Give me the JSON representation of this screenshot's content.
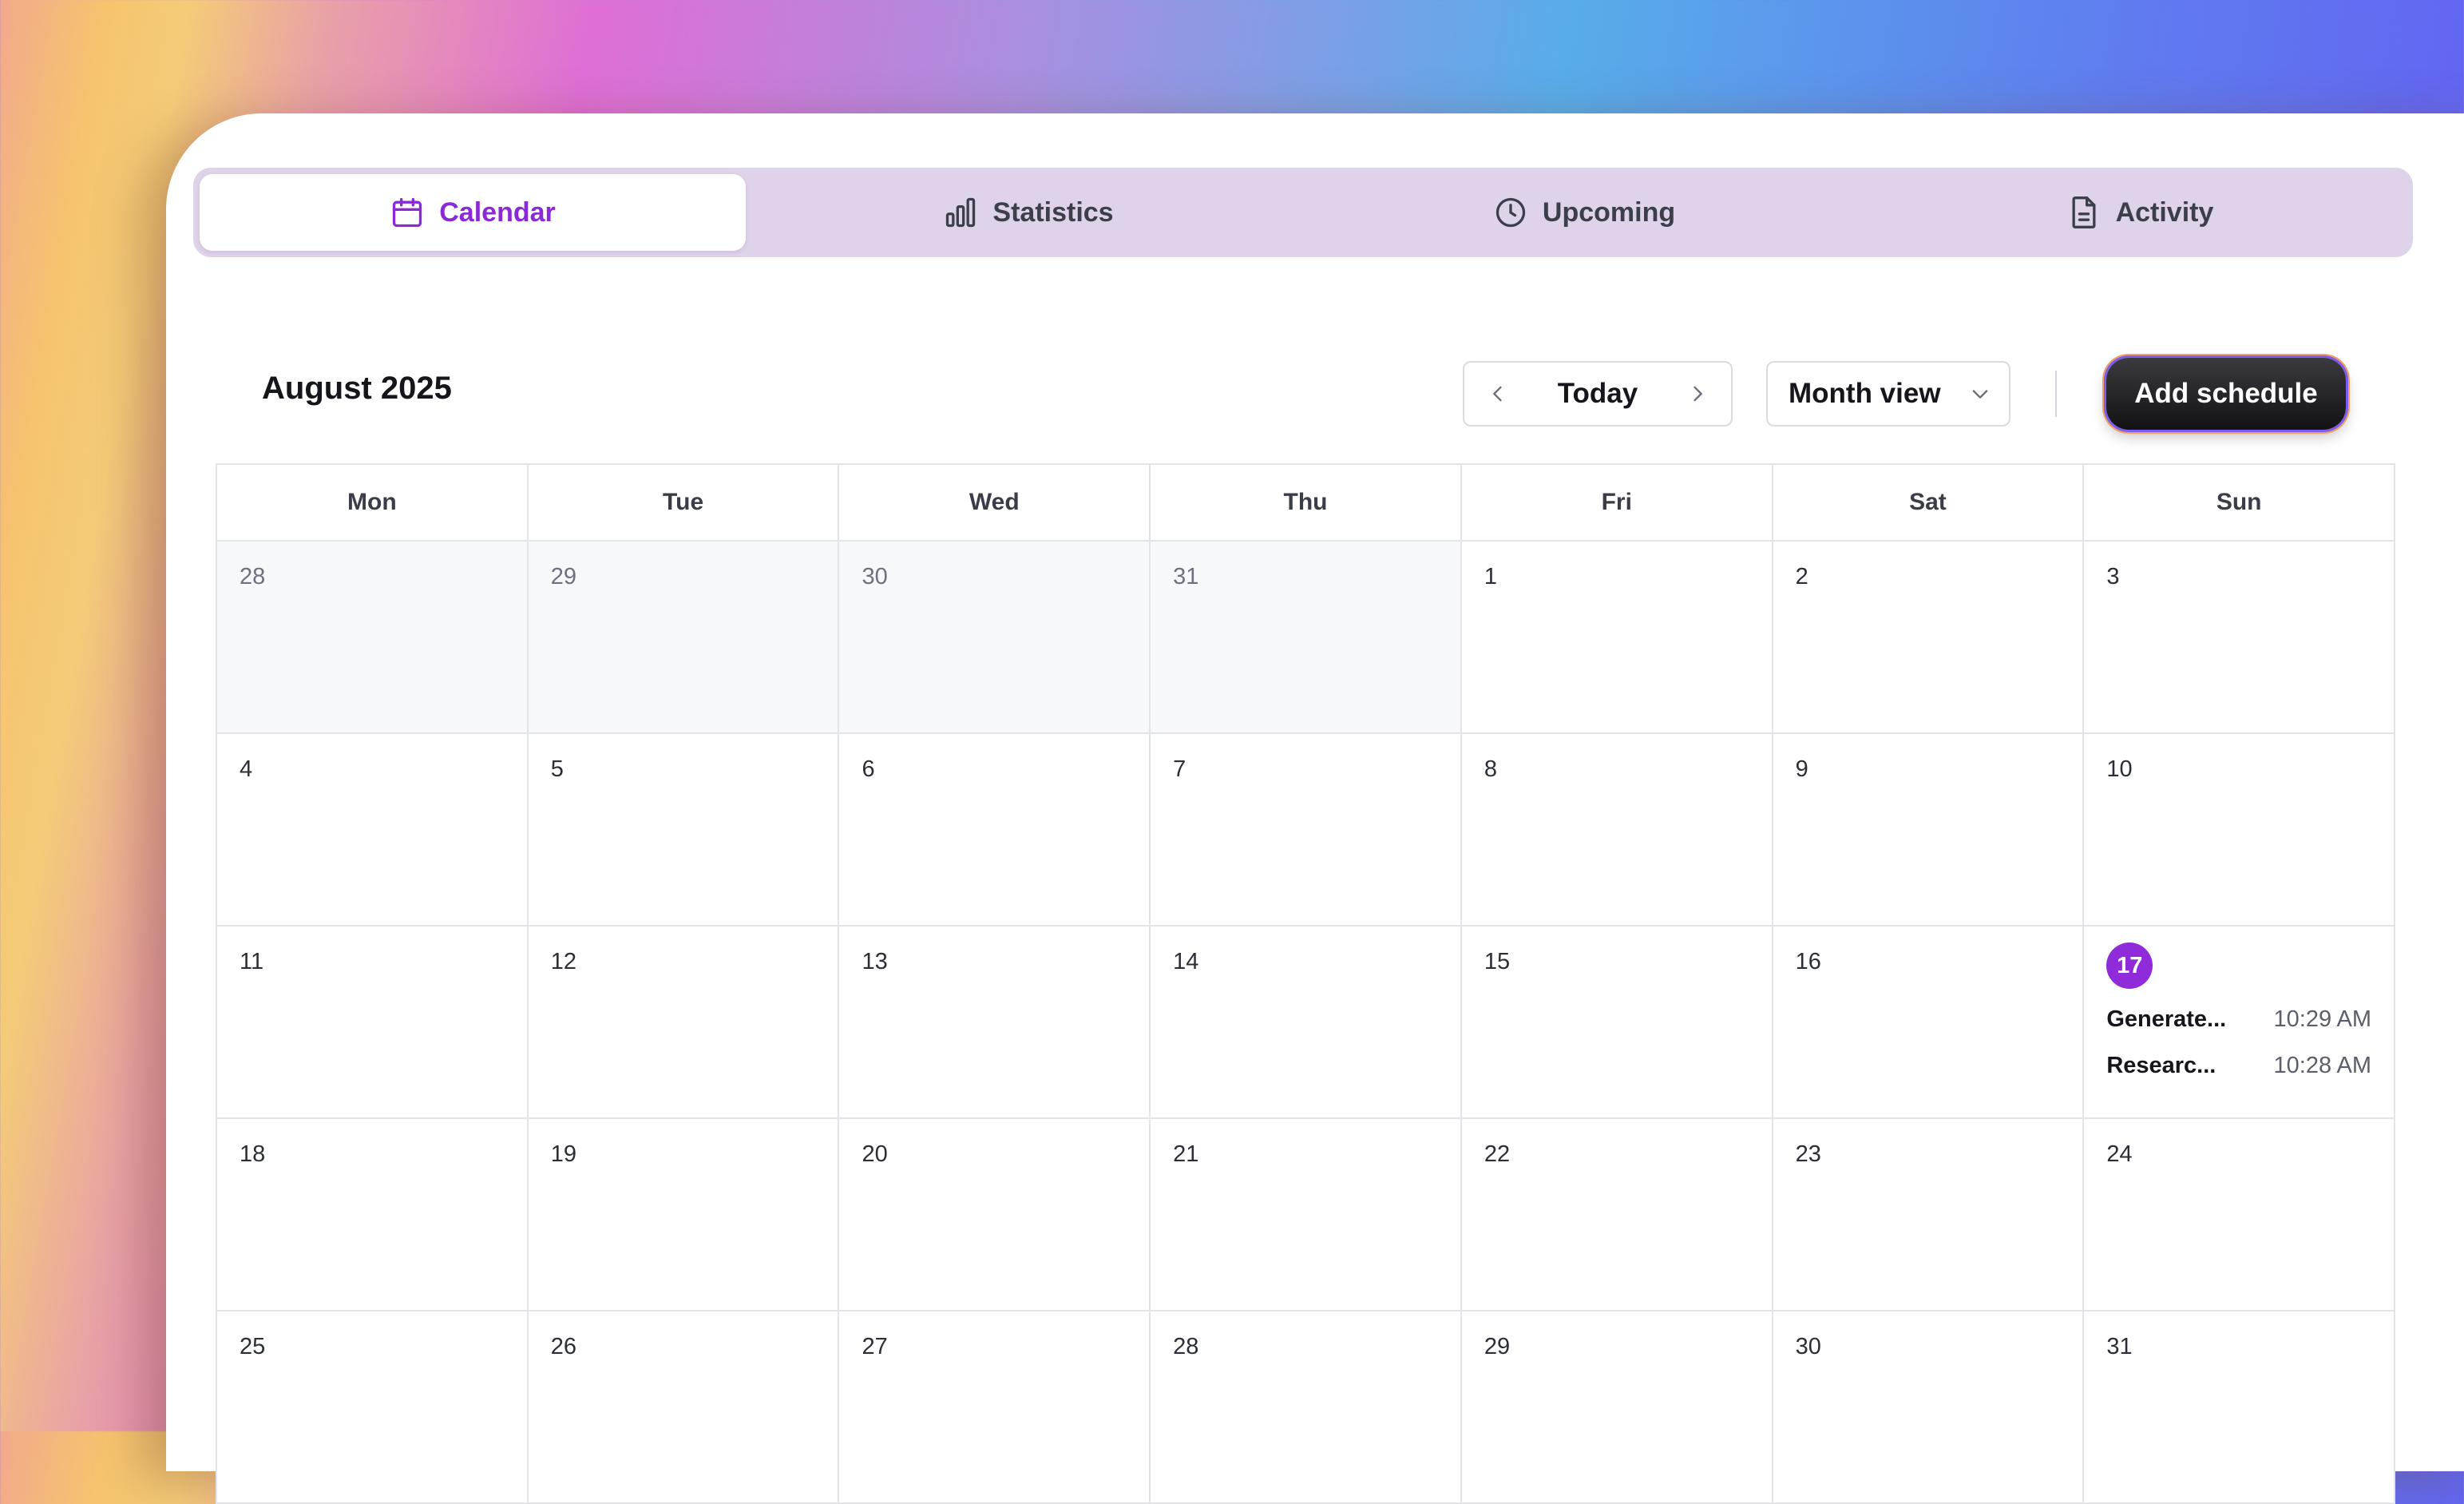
{
  "tabs": [
    {
      "label": "Calendar",
      "icon": "calendar-icon",
      "active": true
    },
    {
      "label": "Statistics",
      "icon": "bar-chart-icon",
      "active": false
    },
    {
      "label": "Upcoming",
      "icon": "clock-icon",
      "active": false
    },
    {
      "label": "Activity",
      "icon": "document-icon",
      "active": false
    }
  ],
  "header": {
    "month_title": "August 2025",
    "today_label": "Today",
    "view_label": "Month view",
    "add_label": "Add schedule"
  },
  "weekdays": [
    "Mon",
    "Tue",
    "Wed",
    "Thu",
    "Fri",
    "Sat",
    "Sun"
  ],
  "weeks": [
    [
      {
        "day": "28",
        "outside": true
      },
      {
        "day": "29",
        "outside": true
      },
      {
        "day": "30",
        "outside": true
      },
      {
        "day": "31",
        "outside": true
      },
      {
        "day": "1"
      },
      {
        "day": "2"
      },
      {
        "day": "3"
      }
    ],
    [
      {
        "day": "4"
      },
      {
        "day": "5"
      },
      {
        "day": "6"
      },
      {
        "day": "7"
      },
      {
        "day": "8"
      },
      {
        "day": "9"
      },
      {
        "day": "10"
      }
    ],
    [
      {
        "day": "11"
      },
      {
        "day": "12"
      },
      {
        "day": "13"
      },
      {
        "day": "14"
      },
      {
        "day": "15"
      },
      {
        "day": "16"
      },
      {
        "day": "17",
        "today": true,
        "events": [
          {
            "title": "Generate...",
            "time": "10:29 AM"
          },
          {
            "title": "Researc...",
            "time": "10:28 AM"
          }
        ]
      }
    ],
    [
      {
        "day": "18"
      },
      {
        "day": "19"
      },
      {
        "day": "20"
      },
      {
        "day": "21"
      },
      {
        "day": "22"
      },
      {
        "day": "23"
      },
      {
        "day": "24"
      }
    ],
    [
      {
        "day": "25"
      },
      {
        "day": "26"
      },
      {
        "day": "27"
      },
      {
        "day": "28"
      },
      {
        "day": "29"
      },
      {
        "day": "30"
      },
      {
        "day": "31"
      }
    ]
  ],
  "colors": {
    "accent": "#8f2bd9",
    "tabbar_bg": "#dfd3ea",
    "outside_day_bg": "#f7f8fa"
  }
}
